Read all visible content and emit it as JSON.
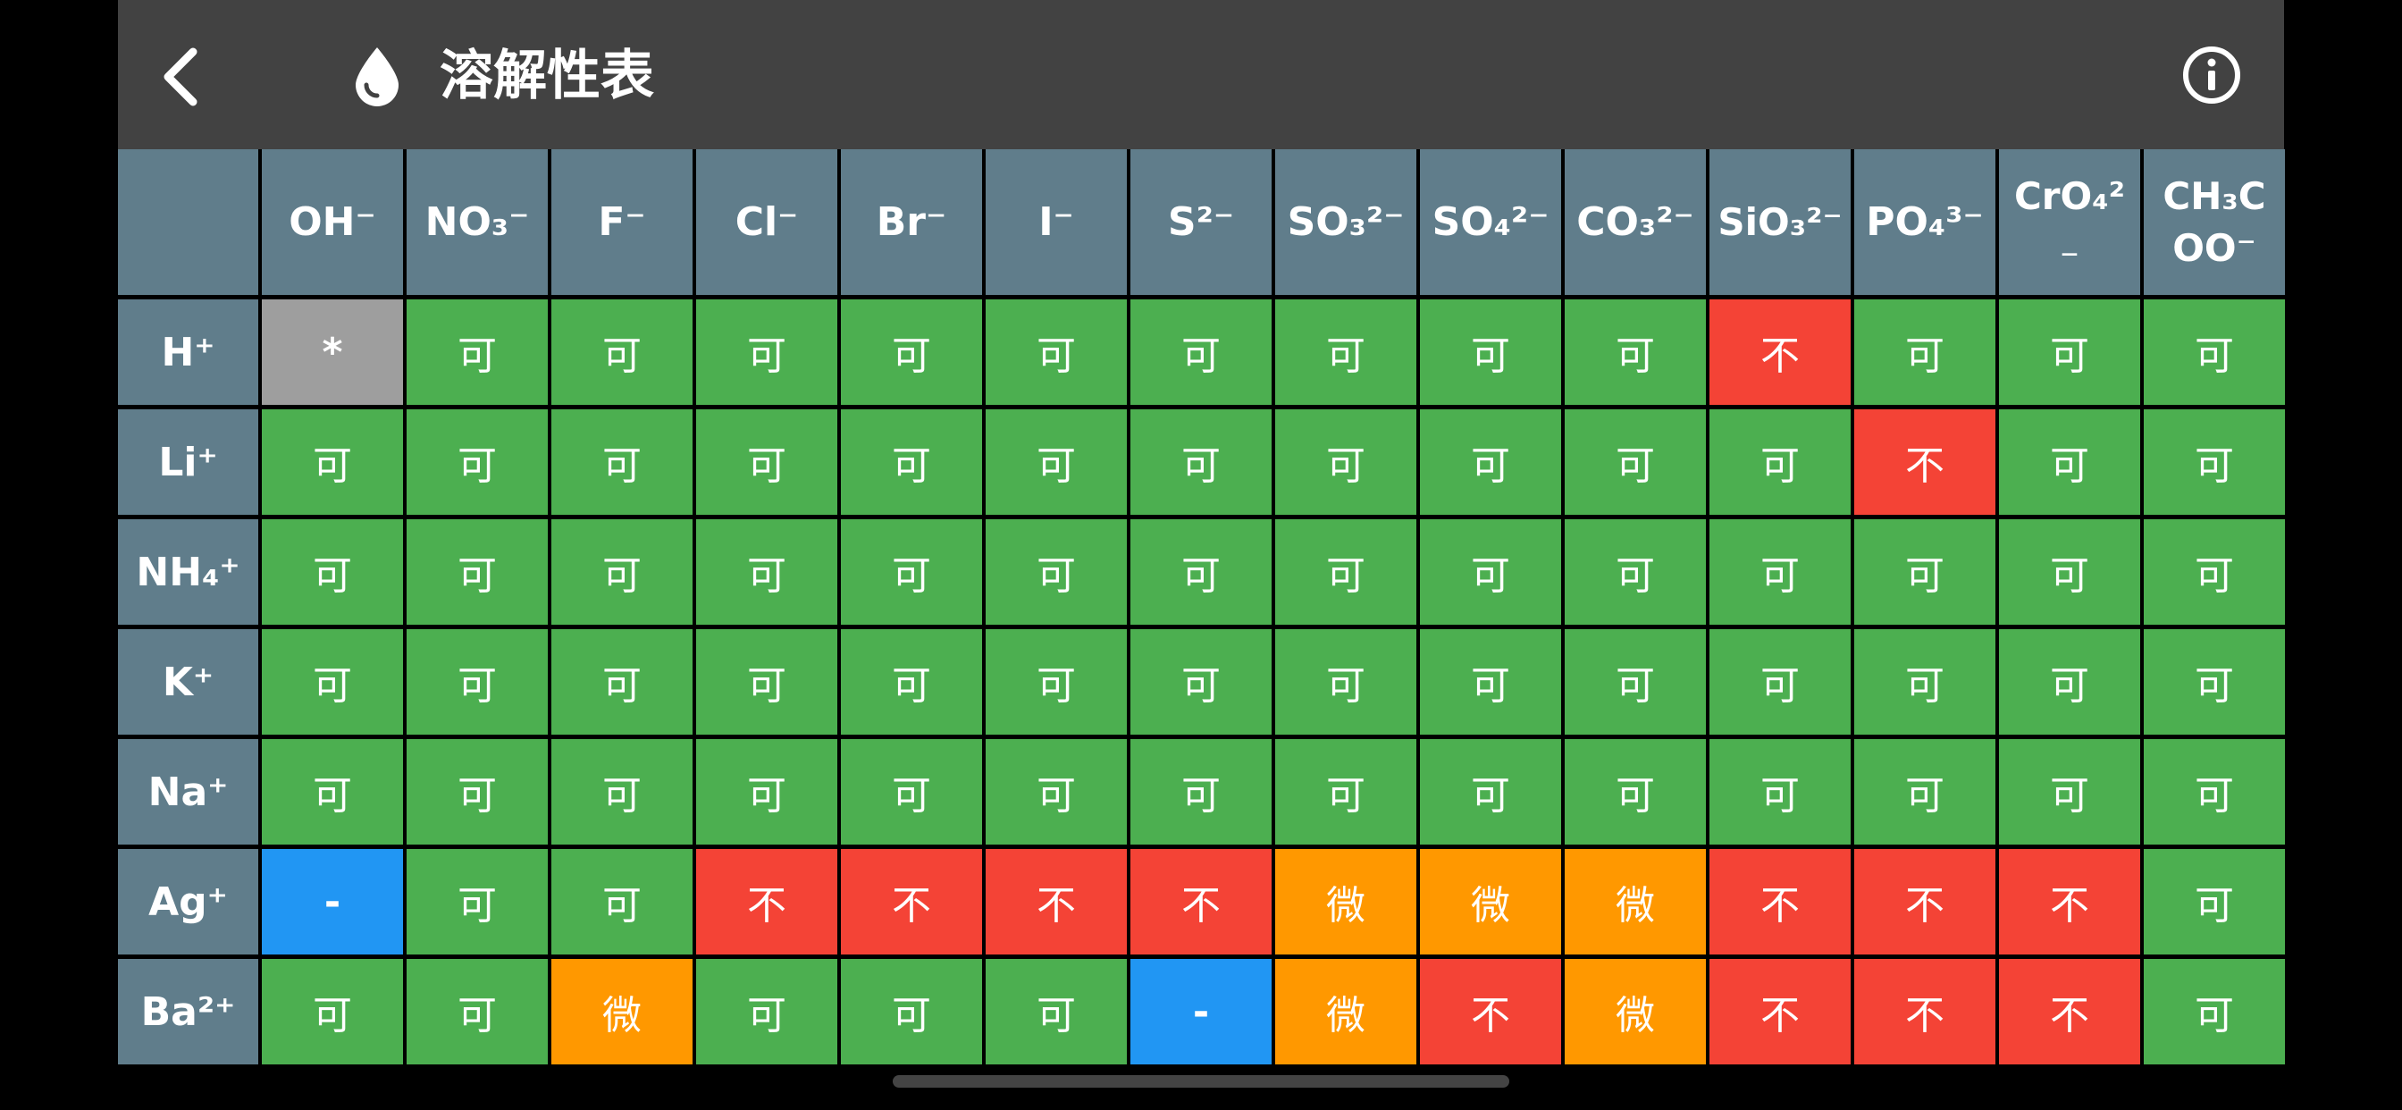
{
  "app": {
    "title": "溶解性表",
    "icons": {
      "back": "chevron-left-icon",
      "title": "water-drop-icon",
      "info": "info-circle-icon"
    },
    "colors": {
      "topbar": "#424242",
      "header_cell": "#607d8b",
      "soluble": "#4caf50",
      "insoluble": "#f44336",
      "slightly_soluble": "#ff9800",
      "nonexistent": "#2196f3",
      "special": "#9e9e9e"
    }
  },
  "table": {
    "corner": "",
    "anions": [
      "OH⁻",
      "NO₃⁻",
      "F⁻",
      "Cl⁻",
      "Br⁻",
      "I⁻",
      "S²⁻",
      "SO₃²⁻",
      "SO₄²⁻",
      "CO₃²⁻",
      "SiO₃²⁻",
      "PO₄³⁻",
      "CrO₄² ₋",
      "CH₃C OO⁻"
    ],
    "rows": [
      {
        "cation": "H⁺",
        "cells": [
          "*",
          "可",
          "可",
          "可",
          "可",
          "可",
          "可",
          "可",
          "可",
          "可",
          "不",
          "可",
          "可",
          "可"
        ]
      },
      {
        "cation": "Li⁺",
        "cells": [
          "可",
          "可",
          "可",
          "可",
          "可",
          "可",
          "可",
          "可",
          "可",
          "可",
          "可",
          "不",
          "可",
          "可"
        ]
      },
      {
        "cation": "NH₄⁺",
        "cells": [
          "可",
          "可",
          "可",
          "可",
          "可",
          "可",
          "可",
          "可",
          "可",
          "可",
          "可",
          "可",
          "可",
          "可"
        ]
      },
      {
        "cation": "K⁺",
        "cells": [
          "可",
          "可",
          "可",
          "可",
          "可",
          "可",
          "可",
          "可",
          "可",
          "可",
          "可",
          "可",
          "可",
          "可"
        ]
      },
      {
        "cation": "Na⁺",
        "cells": [
          "可",
          "可",
          "可",
          "可",
          "可",
          "可",
          "可",
          "可",
          "可",
          "可",
          "可",
          "可",
          "可",
          "可"
        ]
      },
      {
        "cation": "Ag⁺",
        "cells": [
          "-",
          "可",
          "可",
          "不",
          "不",
          "不",
          "不",
          "微",
          "微",
          "微",
          "不",
          "不",
          "不",
          "可"
        ]
      },
      {
        "cation": "Ba²⁺",
        "cells": [
          "可",
          "可",
          "微",
          "可",
          "可",
          "可",
          "-",
          "微",
          "不",
          "微",
          "不",
          "不",
          "不",
          "可"
        ]
      }
    ]
  }
}
